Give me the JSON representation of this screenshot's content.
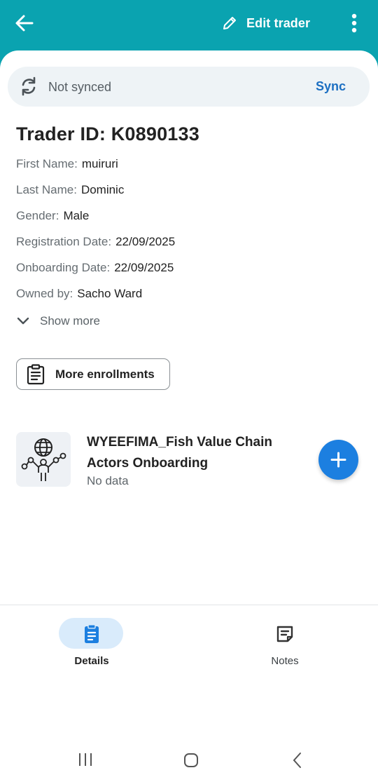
{
  "header": {
    "edit_label": "Edit trader",
    "icons": {
      "back": "arrow-left-icon",
      "edit": "pencil-icon",
      "more": "more-vert-icon"
    }
  },
  "sync": {
    "status": "Not synced",
    "action": "Sync"
  },
  "trader": {
    "id_label": "Trader ID: K0890133",
    "fields": [
      {
        "label": "First Name:",
        "value": "muiruri"
      },
      {
        "label": "Last Name:",
        "value": "Dominic"
      },
      {
        "label": "Gender:",
        "value": "Male"
      },
      {
        "label": "Registration Date:",
        "value": "22/09/2025"
      },
      {
        "label": "Onboarding Date:",
        "value": "22/09/2025"
      },
      {
        "label": "Owned by:",
        "value": "Sacho Ward"
      }
    ],
    "show_more": "Show more"
  },
  "enrollments": {
    "button_label": "More enrollments"
  },
  "program": {
    "title": "WYEEFIMA_Fish Value Chain Actors Onboarding",
    "subtitle": "No data"
  },
  "nav": {
    "items": [
      {
        "label": "Details",
        "icon": "clipboard-icon",
        "active": true
      },
      {
        "label": "Notes",
        "icon": "note-icon",
        "active": false
      }
    ]
  },
  "colors": {
    "header_bg": "#0aa3b0",
    "accent": "#1c7fe0",
    "sync_link": "#1c6fc2",
    "active_pill": "#d9ebfb"
  }
}
